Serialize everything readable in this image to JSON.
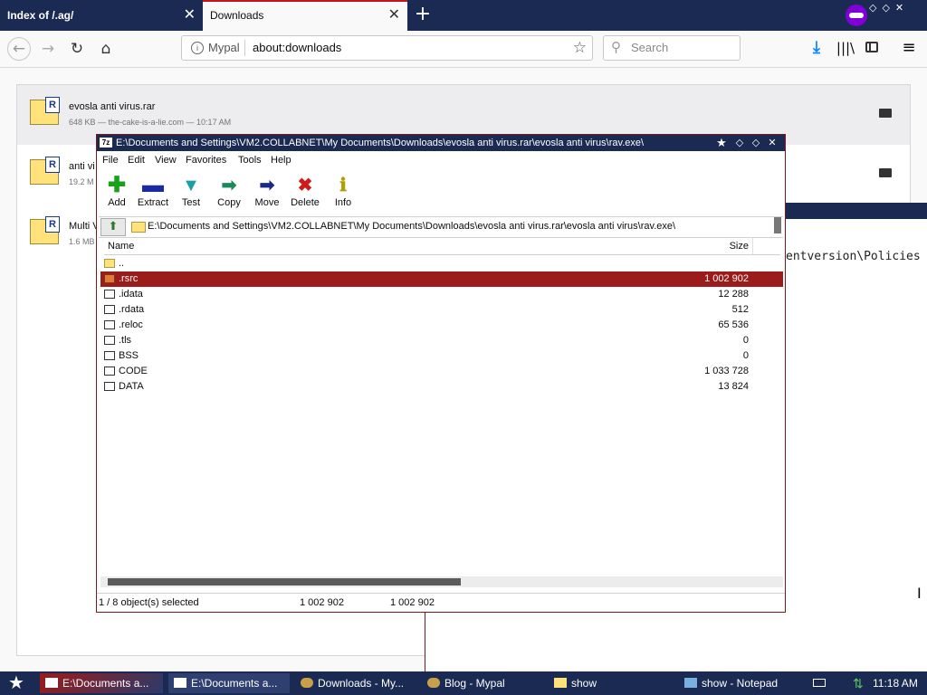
{
  "browser": {
    "tabs": [
      {
        "title": "Index of /.ag/"
      },
      {
        "title": "Downloads"
      }
    ],
    "new_tab": "+",
    "identity_label": "Mypal",
    "url": "about:downloads",
    "search_placeholder": "Search"
  },
  "downloads": [
    {
      "name": "evosla anti virus.rar",
      "meta": "648 KB — the-cake-is-a-lie.com — 10:17 AM"
    },
    {
      "name": "anti vi",
      "meta": "19.2 M"
    },
    {
      "name": "Multi V",
      "meta": "1.6 MB"
    }
  ],
  "console": {
    "visible_text": "entversion\\Policies"
  },
  "zip": {
    "title": "E:\\Documents and Settings\\VM2.COLLABNET\\My Documents\\Downloads\\evosla anti virus.rar\\evosla anti virus\\rav.exe\\",
    "menu": [
      "File",
      "Edit",
      "View",
      "Favorites",
      "Tools",
      "Help"
    ],
    "toolbar": [
      {
        "label": "Add",
        "icon": "plus-icon",
        "color": "#1aa01a"
      },
      {
        "label": "Extract",
        "icon": "minus-icon",
        "color": "#1a2aa0"
      },
      {
        "label": "Test",
        "icon": "check-icon",
        "color": "#1aa0a0"
      },
      {
        "label": "Copy",
        "icon": "arrow-right-icon",
        "color": "#1a8a5a"
      },
      {
        "label": "Move",
        "icon": "arrow-right-icon",
        "color": "#1a2a8a"
      },
      {
        "label": "Delete",
        "icon": "x-icon",
        "color": "#d01a1a"
      },
      {
        "label": "Info",
        "icon": "info-icon",
        "color": "#b0a000"
      }
    ],
    "address": "E:\\Documents and Settings\\VM2.COLLABNET\\My Documents\\Downloads\\evosla anti virus.rar\\evosla anti virus\\rav.exe\\",
    "columns": {
      "name": "Name",
      "size": "Size"
    },
    "files": [
      {
        "name": "..",
        "size": "",
        "type": "folder"
      },
      {
        "name": ".rsrc",
        "size": "1 002 902",
        "type": "folder",
        "selected": true
      },
      {
        "name": ".idata",
        "size": "12 288",
        "type": "file"
      },
      {
        "name": ".rdata",
        "size": "512",
        "type": "file"
      },
      {
        "name": ".reloc",
        "size": "65 536",
        "type": "file"
      },
      {
        "name": ".tls",
        "size": "0",
        "type": "file"
      },
      {
        "name": "BSS",
        "size": "0",
        "type": "file"
      },
      {
        "name": "CODE",
        "size": "1 033 728",
        "type": "file"
      },
      {
        "name": "DATA",
        "size": "13 824",
        "type": "file"
      }
    ],
    "status": {
      "selection": "1 / 8 object(s) selected",
      "size1": "1 002 902",
      "size2": "1 002 902"
    }
  },
  "taskbar": {
    "items": [
      {
        "label": "E:\\Documents a...",
        "icon": "7zip-icon"
      },
      {
        "label": "E:\\Documents a...",
        "icon": "7zip-icon"
      },
      {
        "label": "Downloads - My...",
        "icon": "browser-icon"
      },
      {
        "label": "Blog - Mypal",
        "icon": "browser-icon"
      },
      {
        "label": "show",
        "icon": "folder-icon"
      },
      {
        "label": "show - Notepad",
        "icon": "notepad-icon"
      }
    ],
    "clock": "11:18 AM"
  },
  "colors": {
    "titlebar": "#1b2a52",
    "selection": "#9c1b1b",
    "accent": "#0a84ff"
  }
}
